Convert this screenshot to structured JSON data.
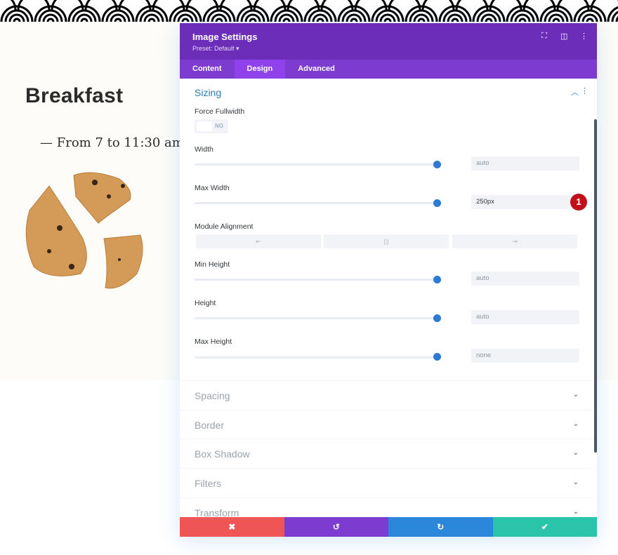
{
  "page": {
    "heading": "Breakfast",
    "subtitle": "— From 7 to 11:30 am"
  },
  "panel": {
    "title": "Image Settings",
    "preset": "Preset: Default ▾",
    "header_icons": [
      "fullscreen-icon",
      "split-view-icon",
      "more-options-icon"
    ],
    "tabs": [
      {
        "label": "Content",
        "active": false
      },
      {
        "label": "Design",
        "active": true
      },
      {
        "label": "Advanced",
        "active": false
      }
    ],
    "sizing": {
      "title": "Sizing",
      "force_fullwidth": {
        "label": "Force Fullwidth",
        "value": "NO"
      },
      "width": {
        "label": "Width",
        "value": "auto"
      },
      "max_width": {
        "label": "Max Width",
        "value": "250px",
        "badge": "1"
      },
      "module_alignment": {
        "label": "Module Alignment",
        "options": [
          "left",
          "center",
          "right"
        ]
      },
      "min_height": {
        "label": "Min Height",
        "value": "auto"
      },
      "height": {
        "label": "Height",
        "value": "auto"
      },
      "max_height": {
        "label": "Max Height",
        "value": "none"
      }
    },
    "collapsed_sections": [
      "Spacing",
      "Border",
      "Box Shadow",
      "Filters",
      "Transform"
    ],
    "footer": {
      "cancel": "✖",
      "undo": "↺",
      "redo": "↻",
      "save": "✔"
    },
    "colors": {
      "header": "#6c2eb9",
      "tabs": "#7e3bd0",
      "cancel": "#ef5555",
      "undo": "#7e3bd0",
      "redo": "#2b87da",
      "save": "#29c4a9",
      "accent": "#2c7ad4"
    }
  }
}
